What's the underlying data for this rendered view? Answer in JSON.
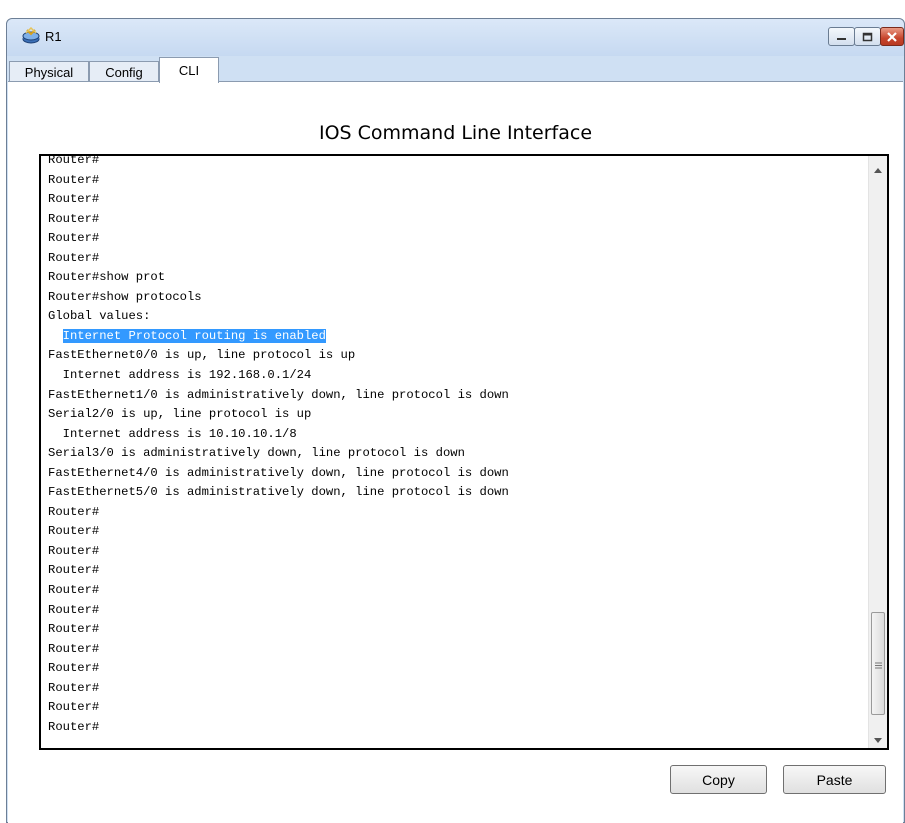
{
  "window": {
    "title": "R1",
    "app_icon": "router-icon",
    "controls": [
      "minimize-icon",
      "maximize-icon",
      "close-icon"
    ]
  },
  "tabs": [
    {
      "label": "Physical",
      "active": false
    },
    {
      "label": "Config",
      "active": false
    },
    {
      "label": "CLI",
      "active": true
    }
  ],
  "cli": {
    "heading": "IOS Command Line Interface",
    "lines": [
      "Router#",
      "Router#",
      "Router#",
      "Router#",
      "Router#",
      "Router#",
      "Router#show prot",
      "Router#show protocols",
      "Global values:",
      "  Internet Protocol routing is enabled",
      "FastEthernet0/0 is up, line protocol is up",
      "  Internet address is 192.168.0.1/24",
      "FastEthernet1/0 is administratively down, line protocol is down",
      "Serial2/0 is up, line protocol is up",
      "  Internet address is 10.10.10.1/8",
      "Serial3/0 is administratively down, line protocol is down",
      "FastEthernet4/0 is administratively down, line protocol is down",
      "FastEthernet5/0 is administratively down, line protocol is down",
      "Router#",
      "Router#",
      "Router#",
      "Router#",
      "Router#",
      "Router#",
      "Router#",
      "Router#",
      "Router#",
      "Router#",
      "Router#",
      "Router#"
    ],
    "highlighted_line": 9,
    "highlighted_text": "Internet Protocol routing is enabled",
    "highlight_color": "#3399ff"
  },
  "buttons": {
    "copy": "Copy",
    "paste": "Paste"
  },
  "colors": {
    "window_frame": "#cfe0f3",
    "close_button": "#c7452d"
  }
}
